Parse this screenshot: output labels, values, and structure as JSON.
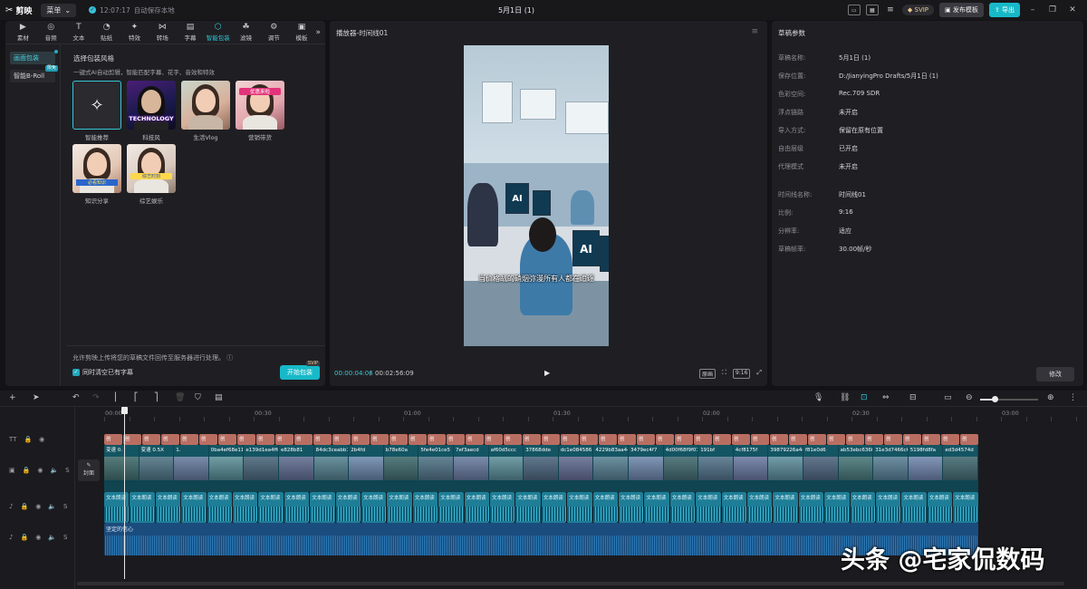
{
  "app": {
    "name": "剪映"
  },
  "titlebar": {
    "menu_label": "菜单",
    "autosave_time": "12:07:17",
    "autosave_text": "自动保存本地",
    "project_title": "5月1日 (1)",
    "svip_label": "SVIP",
    "publish_label": "发布模板",
    "export_label": "导出"
  },
  "categories": [
    {
      "label": "素材",
      "icon": "media-icon"
    },
    {
      "label": "音频",
      "icon": "audio-icon"
    },
    {
      "label": "文本",
      "icon": "text-icon"
    },
    {
      "label": "贴纸",
      "icon": "sticker-icon"
    },
    {
      "label": "特效",
      "icon": "effects-icon"
    },
    {
      "label": "转场",
      "icon": "transition-icon"
    },
    {
      "label": "字幕",
      "icon": "caption-icon"
    },
    {
      "label": "智能包装",
      "icon": "smart-pack-icon"
    },
    {
      "label": "滤镜",
      "icon": "filter-icon"
    },
    {
      "label": "调节",
      "icon": "adjust-icon"
    },
    {
      "label": "模板",
      "icon": "template-icon"
    }
  ],
  "side_tabs": [
    {
      "label": "画面包装"
    },
    {
      "label": "智能B-Roll",
      "badge": "限免"
    }
  ],
  "packaging": {
    "title": "选择包装风格",
    "subtitle": "一键式AI自动剪辑，智能匹配字幕、花字、音效和特效",
    "templates": [
      {
        "label": "智能推荐",
        "caption": ""
      },
      {
        "label": "科技风",
        "caption": "TECHNOLOGY"
      },
      {
        "label": "生活Vlog",
        "caption": ""
      },
      {
        "label": "营销带货",
        "caption": "优惠来啦"
      },
      {
        "label": "知识分享",
        "caption": "必看知识"
      },
      {
        "label": "综艺娱乐",
        "caption": "综艺时刻"
      }
    ],
    "footer_text": "允许剪映上传将您的草稿文件回传至服务器进行处理。",
    "checkbox_label": "同时清空已有字幕",
    "start_label": "开始包装",
    "start_badge": "SVIP"
  },
  "player": {
    "title": "播放器-时间线01",
    "subtitle_text": "当价格战的硝烟弥漫所有人都在追逐",
    "screen_text": "AI",
    "current_time": "00:00:04:06",
    "total_time": "00:02:56:09",
    "full_label": "原画",
    "ratio_label": "9:16"
  },
  "draft": {
    "title": "草稿参数",
    "rows1": [
      {
        "label": "草稿名称:",
        "value": "5月1日 (1)"
      },
      {
        "label": "保存位置:",
        "value": "D:/JianyingPro Drafts/5月1日 (1)"
      },
      {
        "label": "色彩空间:",
        "value": "Rec.709 SDR"
      },
      {
        "label": "浮点链路",
        "value": "未开启"
      },
      {
        "label": "导入方式:",
        "value": "保留在原有位置"
      },
      {
        "label": "自由层级",
        "value": "已开启"
      },
      {
        "label": "代理模式",
        "value": "未开启"
      }
    ],
    "rows2": [
      {
        "label": "时间线名称:",
        "value": "时间线01"
      },
      {
        "label": "比例:",
        "value": "9:16"
      },
      {
        "label": "分辨率:",
        "value": "适应"
      },
      {
        "label": "草稿帧率:",
        "value": "30.00帧/秒"
      }
    ],
    "modify_label": "修改"
  },
  "timeline": {
    "ruler": [
      "00:00",
      "00:30",
      "01:00",
      "01:30",
      "02:00",
      "02:30",
      "03:00"
    ],
    "cover_label": "封面",
    "text_clip_label": "创",
    "video_clips": [
      "变速 0.",
      "变速 0.5X",
      "1.",
      "0ba4ef68e11",
      "e139d1ea4ffd49ac9507",
      "e828b81",
      "84dc3ceabb7",
      "2b4fd",
      "b78e60a",
      "5fe4e01ce5",
      "7ef3aecd",
      "af60d5ccc",
      "37868dde",
      "dc1e084586",
      "4229b83aa44",
      "3479ec4f7",
      "4d00f68f9f0743",
      "191bf",
      "4cf8175f",
      "39879226a4c5",
      "f81e0d6",
      "ab53ebc636f",
      "31e3d7466c6",
      "5198fd8fa",
      "ed3d4574d"
    ],
    "tts_label": "文本朗读",
    "music_label": "坚定的信心",
    "zoom_level": 0.25
  },
  "watermark": "头条 @宅家侃数码"
}
